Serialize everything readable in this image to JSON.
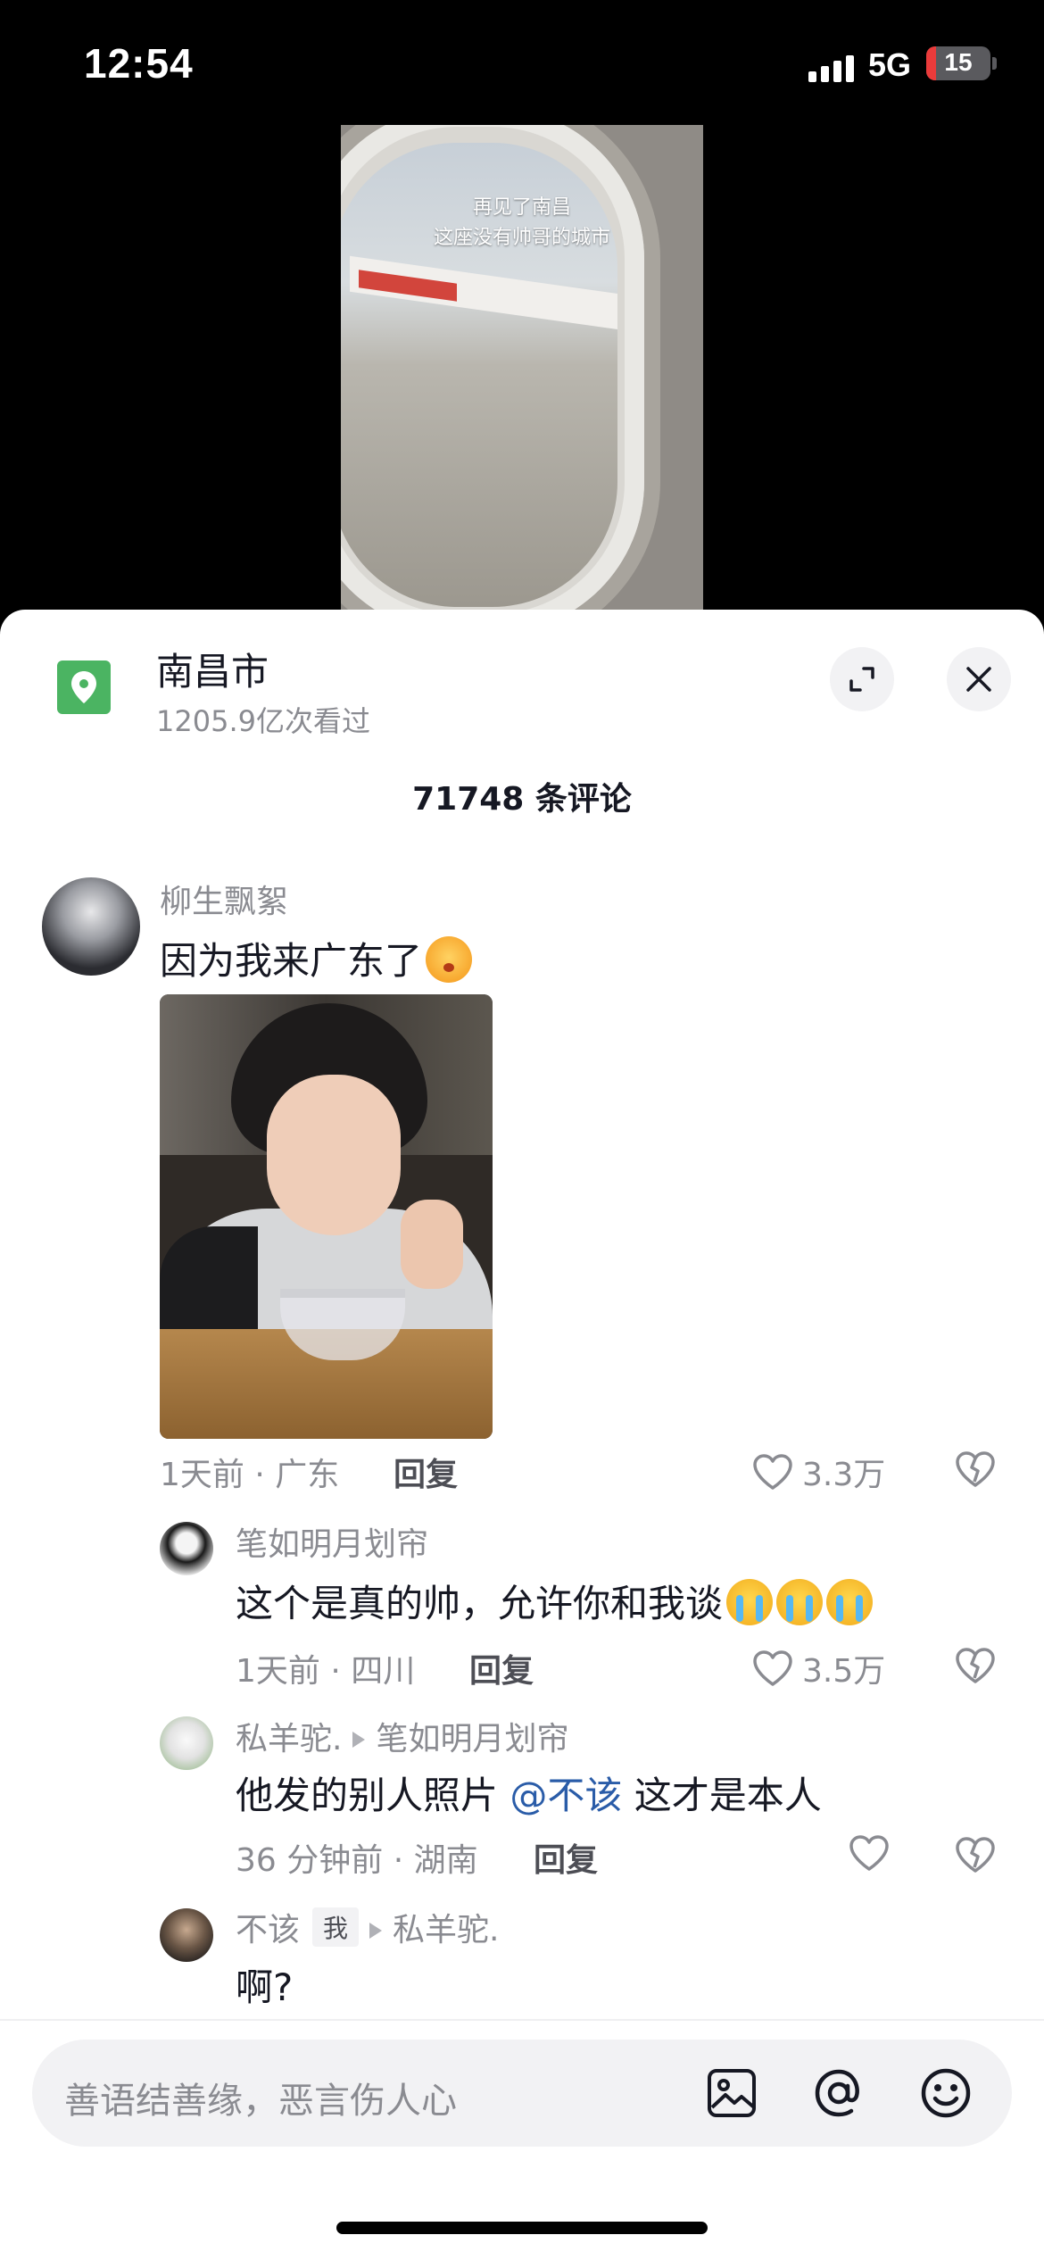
{
  "status_bar": {
    "time": "12:54",
    "network": "5G",
    "battery": "15",
    "battery_level": 0.15
  },
  "video": {
    "caption_line1": "再见了南昌",
    "caption_line2": "这座没有帅哥的城市"
  },
  "header": {
    "location_title": "南昌市",
    "view_count": "1205.9亿次看过",
    "comment_count": "71748 条评论"
  },
  "comments": [
    {
      "username": "柳生飘絮",
      "text": "因为我来广东了",
      "time_location": "1天前 · 广东",
      "reply_label": "回复",
      "likes": "3.3万"
    }
  ],
  "replies": [
    {
      "username": "笔如明月划帘",
      "text": "这个是真的帅，允许你和我谈",
      "time_location": "1天前 · 四川",
      "reply_label": "回复",
      "likes": "3.5万"
    },
    {
      "username": "私羊驼.",
      "reply_to": "笔如明月划帘",
      "text_before": "他发的别人照片",
      "mention": "@不该",
      "text_after": "这才是本人",
      "time_location": "36 分钟前 · 湖南",
      "reply_label": "回复"
    },
    {
      "username": "不该",
      "tag": "我",
      "reply_to": "私羊驼.",
      "text": "啊?"
    }
  ],
  "input": {
    "placeholder": "善语结善缘，恶言伤人心"
  },
  "icons": {
    "location": "location-pin-icon",
    "expand": "expand-icon",
    "close": "close-icon",
    "like": "heart-icon",
    "dislike": "broken-heart-icon",
    "image": "image-icon",
    "mention": "at-icon",
    "emoji": "smiley-icon"
  },
  "colors": {
    "accent_green": "#4bb462",
    "mention_blue": "#2a5ca8",
    "muted_text": "#8a8b91"
  }
}
